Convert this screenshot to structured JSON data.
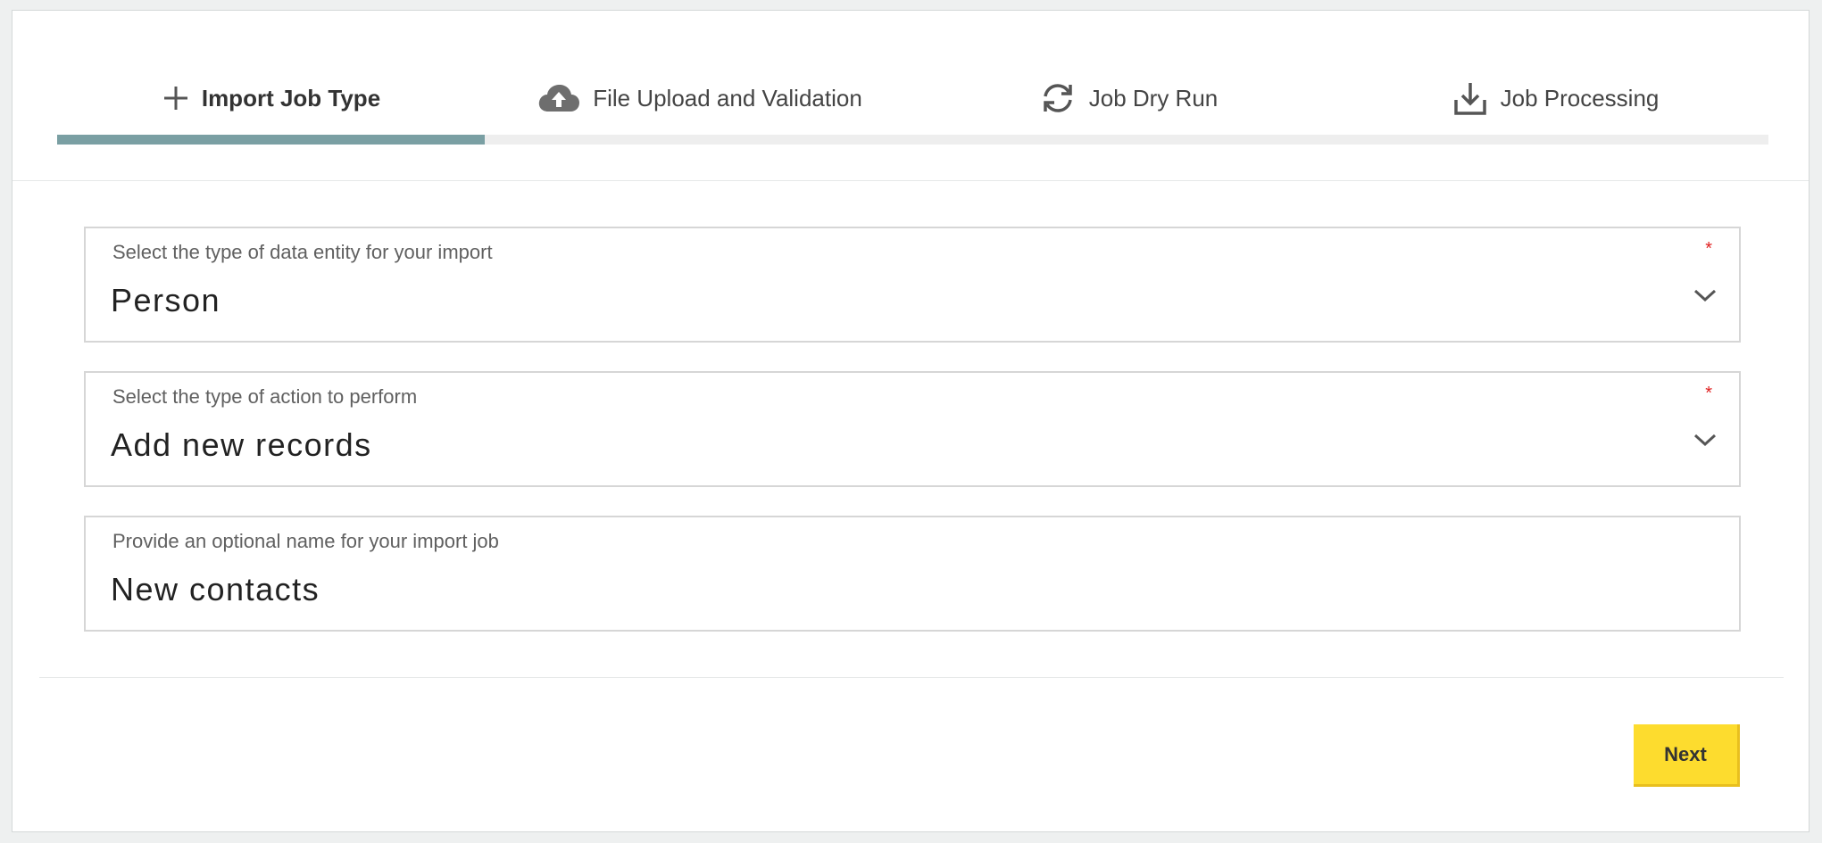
{
  "stepper": {
    "steps": [
      {
        "label": "Import Job Type",
        "icon": "plus-icon",
        "active": true
      },
      {
        "label": "File Upload and Validation",
        "icon": "cloud-upload-icon",
        "active": false
      },
      {
        "label": "Job Dry Run",
        "icon": "refresh-icon",
        "active": false
      },
      {
        "label": "Job Processing",
        "icon": "download-icon",
        "active": false
      }
    ],
    "progress_fraction": 0.25,
    "progress_color": "#7a9fa3"
  },
  "form": {
    "entity_type": {
      "label": "Select the type of data entity for your import",
      "value": "Person",
      "required_marker": "*"
    },
    "action_type": {
      "label": "Select the type of action to perform",
      "value": "Add new records",
      "required_marker": "*"
    },
    "job_name": {
      "label": "Provide an optional name for your import job",
      "value": "New contacts"
    }
  },
  "footer": {
    "next_label": "Next",
    "next_color": "#fddc2e"
  }
}
